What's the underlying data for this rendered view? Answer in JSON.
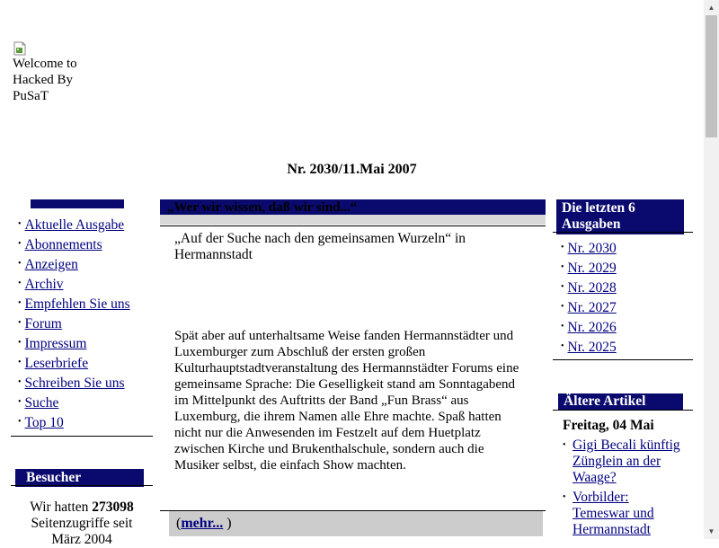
{
  "header": {
    "broken_image_alt": "Welcome to Hacked By PuSaT",
    "issue_date": "Nr. 2030/11.Mai 2007"
  },
  "nav": {
    "items": [
      {
        "label": "Aktuelle Ausgabe"
      },
      {
        "label": "Abonnements"
      },
      {
        "label": "Anzeigen"
      },
      {
        "label": "Archiv"
      },
      {
        "label": "Empfehlen Sie uns"
      },
      {
        "label": "Forum"
      },
      {
        "label": "Impressum"
      },
      {
        "label": "Leserbriefe"
      },
      {
        "label": "Schreiben Sie uns"
      },
      {
        "label": "Suche"
      },
      {
        "label": "Top 10"
      }
    ]
  },
  "visitors": {
    "title": "Besucher",
    "text_before": "Wir hatten",
    "count": "273098",
    "text_after": "Seitenzugriffe seit März 2004"
  },
  "article": {
    "title": "„Wer wir wissen, daß wir sind...“",
    "lead": "„Auf der Suche nach den gemeinsamen Wurzeln“ in Hermannstadt",
    "body": "Spät aber auf unterhaltsame Weise fanden Hermannstädter und Luxemburger zum Abschluß der ersten großen Kulturhauptstadtveranstaltung des Hermannstädter Forums eine gemeinsame Sprache: Die Geselligkeit stand am Sonntagabend im Mittelpunkt des Auftritts der Band „Fun Brass“ aus Luxemburg, die ihrem Namen alle Ehre machte. Spaß hatten nicht nur die Anwesenden im Festzelt auf dem Huetplatz zwischen Kirche und Brukenthalschule, sondern auch die Musiker selbst, die einfach Show machten.",
    "more_open": "(",
    "more_link": "mehr...",
    "more_close": ")"
  },
  "last_issues": {
    "title": "Die letzten 6 Ausgaben",
    "items": [
      {
        "label": "Nr. 2030"
      },
      {
        "label": "Nr. 2029"
      },
      {
        "label": "Nr. 2028"
      },
      {
        "label": "Nr. 2027"
      },
      {
        "label": "Nr. 2026"
      },
      {
        "label": "Nr. 2025"
      }
    ]
  },
  "older_articles": {
    "title": "Ältere Artikel",
    "date": "Freitag, 04 Mai",
    "items": [
      {
        "label": "Gigi Becali künftig Zünglein an der Waage?"
      },
      {
        "label": "Vorbilder: Temeswar und Hermannstadt"
      }
    ]
  },
  "bullet_glyph": "•",
  "colors": {
    "header_bar": "#0a0a6e",
    "link": "#000080",
    "more_bar": "#cccccc"
  }
}
